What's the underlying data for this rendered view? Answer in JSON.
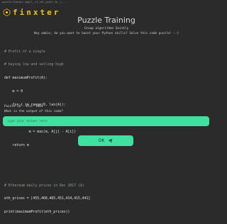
{
  "breadcrumb": "puzzle.finxter.com/?__cf_chl_jschl_tk__=...",
  "brand": {
    "name": "finxter",
    "logo_icon": "finxter-logo-icon",
    "accent": "#f1c40f"
  },
  "page": {
    "title": "Puzzle Training",
    "subtitle": "Group algorithms Quickly",
    "intro": "Hey admin, do you want to boost your Python skills? Solve this code puzzle! :-)"
  },
  "code_lines": [
    "# Profit of a single",
    "# buying low and selling high",
    "def maximumProfit(A):",
    "    m = 0",
    "    for i in range(0, len(A)):",
    "        for j in range (i + 1, len(A)):",
    "            m = max(m, A[j] - A[i])",
    "    return m",
    "",
    "",
    "# Ethereum daily prices in Dec 2017 ($)",
    "eth_prices = [455,460,465,451,414,415,441]",
    "print(maximumProfit(eth_prices))"
  ],
  "puzzle": {
    "id_text": "Puzzle 26 - Elo: 1444",
    "question": "What is the output of this code?"
  },
  "answer": {
    "placeholder": "Type your answer here"
  },
  "ok_button": {
    "label": "OK",
    "icon": "send-icon"
  },
  "colors": {
    "background": "#2b2b2b",
    "accent_green": "#40e0a0",
    "keyword_red": "#ff6d6d"
  }
}
